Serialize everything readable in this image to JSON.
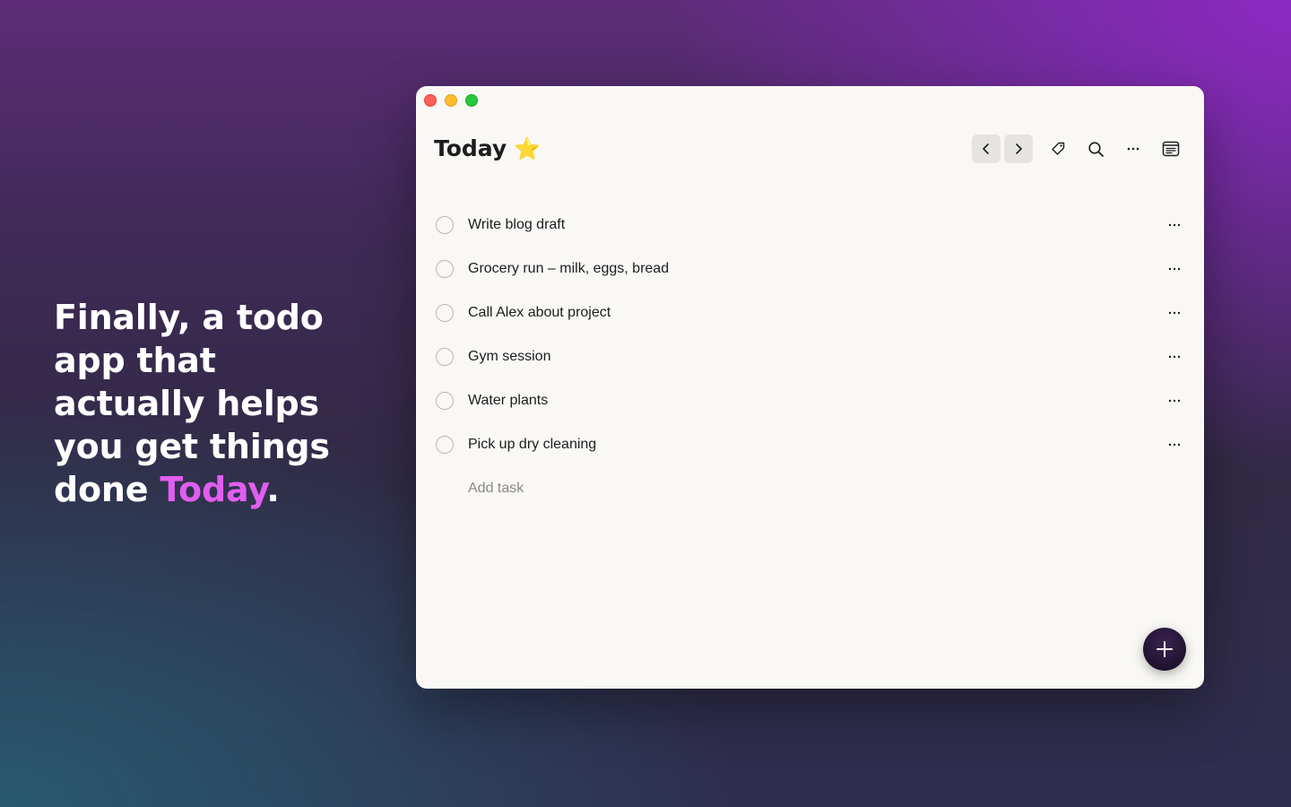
{
  "headline": {
    "text": "Finally, a todo app that actually helps you get things done ",
    "accent": "Today",
    "end": ".",
    "accent_color": "#e15ef0"
  },
  "window": {
    "title": "Today",
    "title_emoji": "⭐",
    "toolbar": {
      "icons": [
        "chevron-left-icon",
        "chevron-right-icon",
        "tag-icon",
        "search-icon",
        "more-icon",
        "notes-icon"
      ]
    },
    "tasks": [
      {
        "text": "Write blog draft"
      },
      {
        "text": "Grocery run – milk, eggs, bread"
      },
      {
        "text": "Call Alex about project"
      },
      {
        "text": "Gym session"
      },
      {
        "text": "Water plants"
      },
      {
        "text": "Pick up dry cleaning"
      }
    ],
    "add_task_placeholder": "Add task",
    "fab_icon": "plus-icon"
  },
  "colors": {
    "window_bg": "#f9f8f5",
    "fab_bg": "#1f1330",
    "traffic_close": "#fe5f57",
    "traffic_minimize": "#febc2e",
    "traffic_maximize": "#28c840"
  }
}
